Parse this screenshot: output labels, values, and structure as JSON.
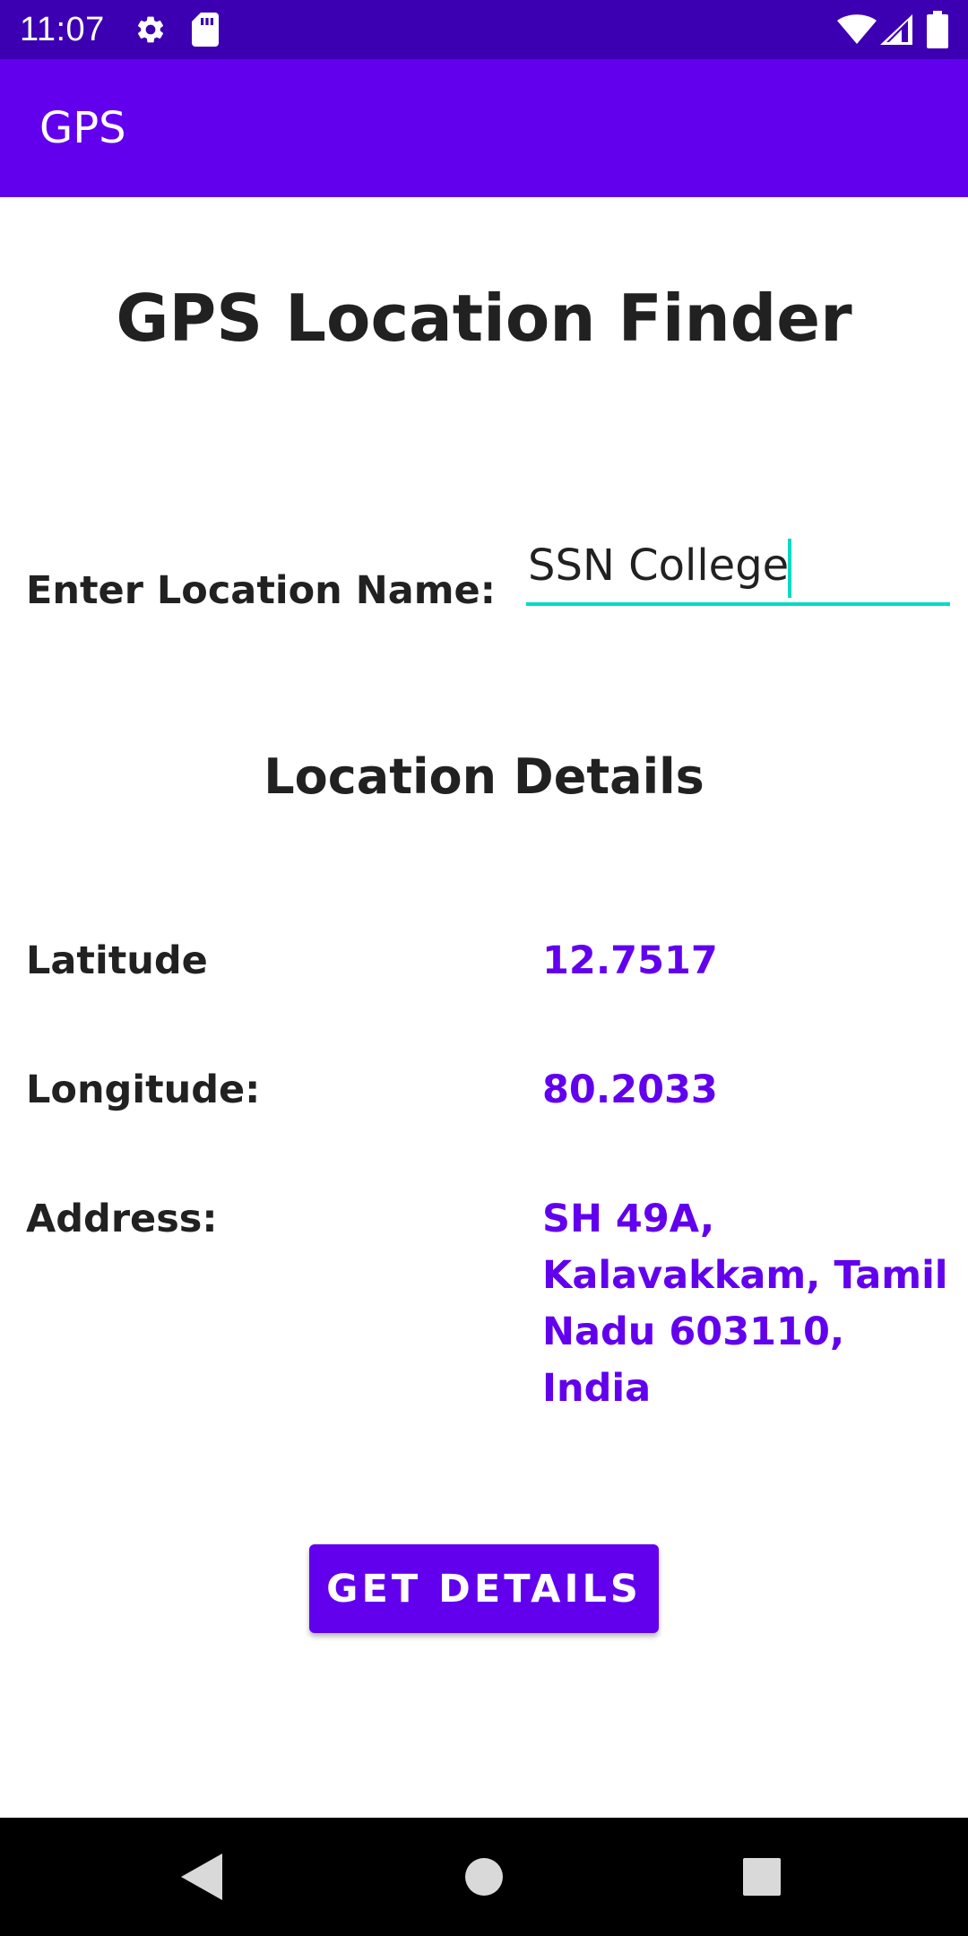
{
  "status_bar": {
    "time": "11:07",
    "icons": [
      "gear-icon",
      "sd-card-icon",
      "wifi-icon",
      "signal-icon",
      "battery-icon"
    ]
  },
  "app_bar": {
    "title": "GPS",
    "color": "#6200ee"
  },
  "page": {
    "heading": "GPS Location Finder"
  },
  "location_input": {
    "label": "Enter Location Name:",
    "value": "SSN College"
  },
  "details": {
    "heading": "Location Details",
    "latitude_label": "Latitude",
    "latitude_value": "12.7517",
    "longitude_label": "Longitude:",
    "longitude_value": "80.2033",
    "address_label": "Address:",
    "address_value": "SH 49A, Kalavakkam, Tamil Nadu 603110, India"
  },
  "button": {
    "label": "GET DETAILS"
  },
  "nav_bar": {
    "icons": [
      "back-icon",
      "home-icon",
      "recents-icon"
    ]
  },
  "colors": {
    "status_bar": "#3c00b2",
    "primary": "#6200ee",
    "accent": "#03dac5",
    "text": "#212121"
  }
}
